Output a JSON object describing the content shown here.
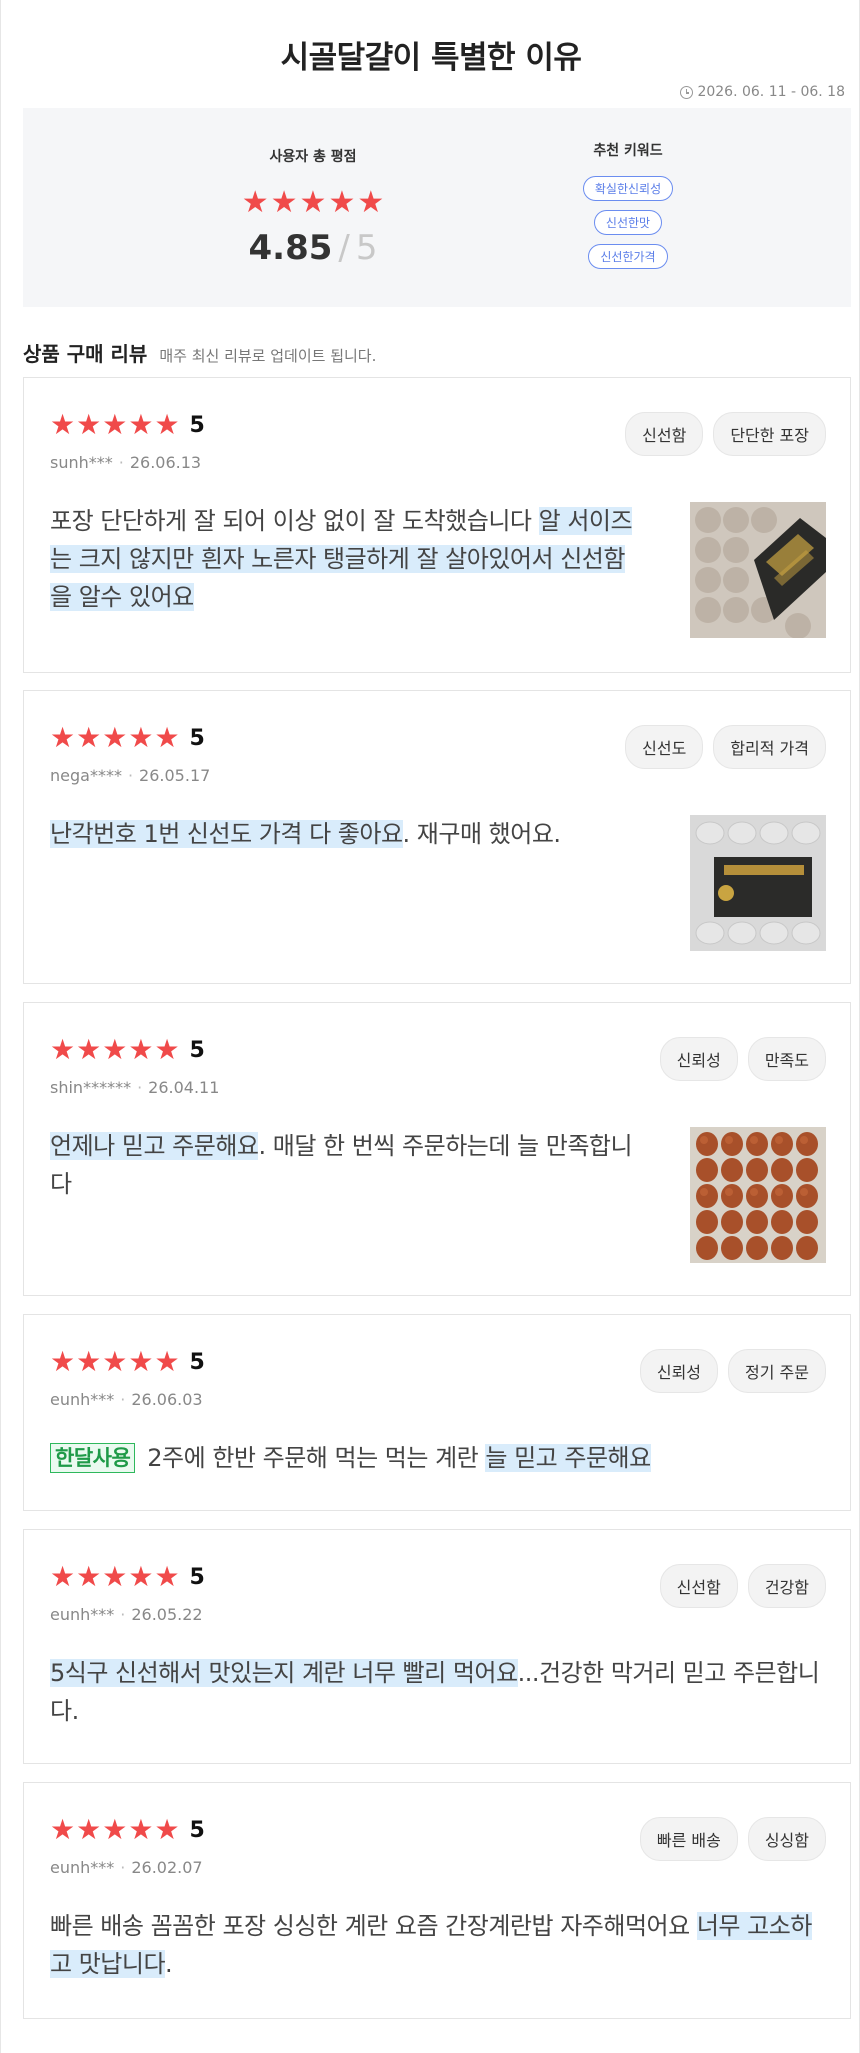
{
  "header": {
    "title": "시골달걀이 특별한 이유",
    "period": "2026. 06. 11 - 06. 18"
  },
  "summary": {
    "rating_label": "사용자 총 평점",
    "score": "4.85",
    "slash": "/",
    "max": "5",
    "stars": 5,
    "keyword_label": "추천 키워드",
    "keywords": [
      "확실한신뢰성",
      "신선한맛",
      "신선한가격"
    ],
    "star_color": "#f04a4a",
    "keyword_color": "#5a7de8"
  },
  "section": {
    "title": "상품 구매 리뷰",
    "subtitle": "매주 최신 리뷰로 업데이트 됩니다."
  },
  "reviews": [
    {
      "stars": 5,
      "score": "5",
      "user": "sunh***",
      "date": "26.06.13",
      "tags": [
        "신선함",
        "단단한 포장"
      ],
      "text_plain": "포장 단단하게 잘 되어 이상 없이 잘 도착했습니다 ",
      "text_highlight": "알 서이즈는 크지 않지만 흰자 노른자 탱글하게 잘 살아있어서 신선함을 알수 있어요",
      "text_after": "",
      "image": "egg-tray-with-label-photo"
    },
    {
      "stars": 5,
      "score": "5",
      "user": "nega****",
      "date": "26.05.17",
      "tags": [
        "신선도",
        "합리적 가격"
      ],
      "text_plain": "",
      "text_highlight": "난각번호 1번 신선도 가격 다 좋아요",
      "text_after": ". 재구매 했어요.",
      "image": "egg-box-package-photo"
    },
    {
      "stars": 5,
      "score": "5",
      "user": "shin******",
      "date": "26.04.11",
      "tags": [
        "신뢰성",
        "만족도"
      ],
      "text_plain": "",
      "text_highlight": "언제나 믿고 주문해요",
      "text_after": ". 매달 한 번씩 주문하는데 늘 만족합니다",
      "image": "brown-eggs-tray-photo"
    },
    {
      "stars": 5,
      "score": "5",
      "user": "eunh***",
      "date": "26.06.03",
      "tags": [
        "신뢰성",
        "정기 주문"
      ],
      "badge": "한달사용",
      "text_plain": "2주에 한반 주문해 먹는 먹는 계란 ",
      "text_highlight": "늘 믿고 주문해요",
      "text_after": ""
    },
    {
      "stars": 5,
      "score": "5",
      "user": "eunh***",
      "date": "26.05.22",
      "tags": [
        "신선함",
        "건강함"
      ],
      "text_plain": "",
      "text_highlight": "5식구 신선해서 맛있는지 계란 너무 빨리 먹어요",
      "text_after": "...건강한 막거리 믿고 주믄합니다."
    },
    {
      "stars": 5,
      "score": "5",
      "user": "eunh***",
      "date": "26.02.07",
      "tags": [
        "빠른 배송",
        "싱싱함"
      ],
      "text_plain": "빠른 배송 꼼꼼한 포장 싱싱한 계란 요즘 간장계란밥 자주해먹어요 ",
      "text_highlight": "너무 고소하고 맛납니다",
      "text_after": "."
    }
  ]
}
